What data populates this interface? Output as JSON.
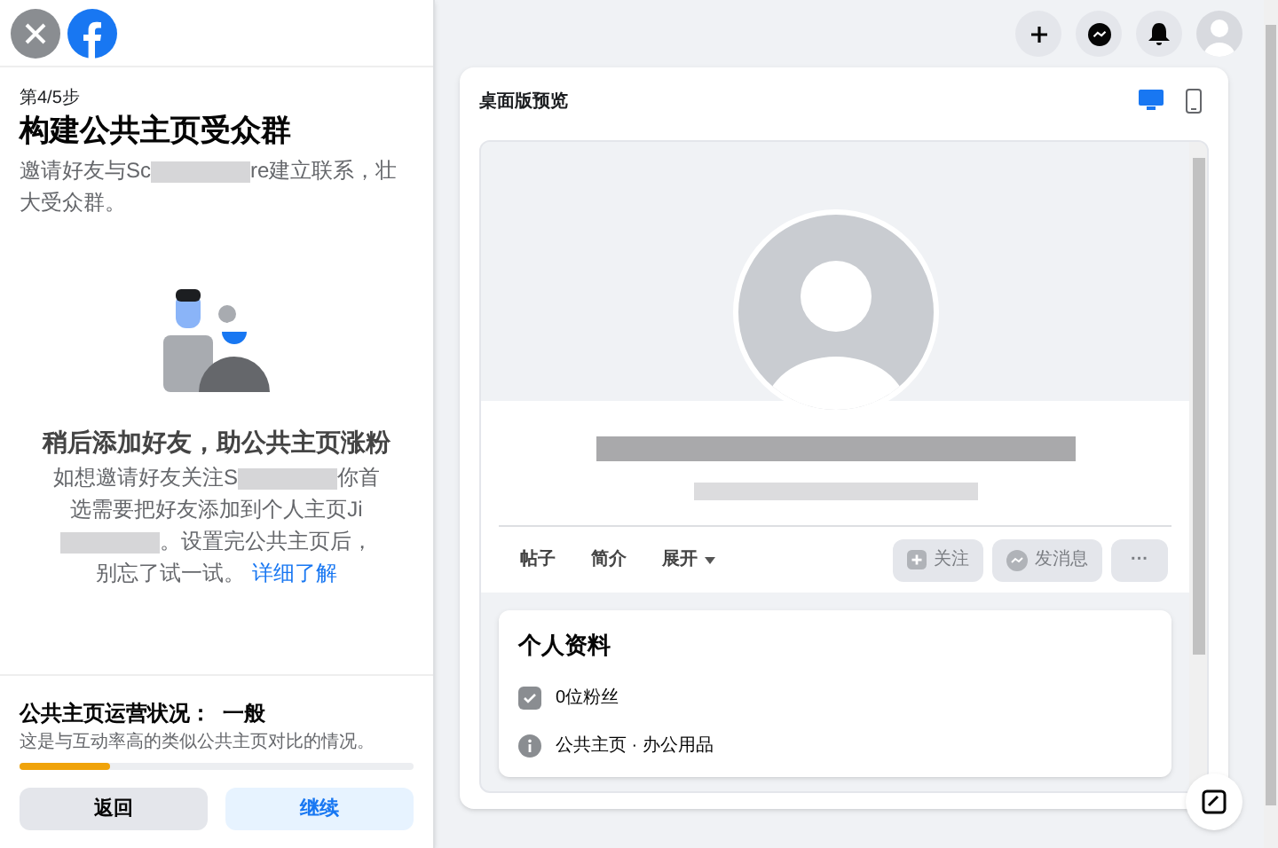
{
  "wizard": {
    "step": "第4/5步",
    "title": "构建公共主页受众群",
    "intro": [
      {
        "kind": "text",
        "text": "邀请好友与Sc"
      },
      {
        "kind": "blur"
      },
      {
        "kind": "text",
        "text": "re建立联系，壮大受众群。"
      }
    ],
    "promo_title": "稍后添加好友，助公共主页涨粉",
    "promo_text": [
      {
        "kind": "text",
        "text": "如想邀请好友关注S"
      },
      {
        "kind": "blur"
      },
      {
        "kind": "text",
        "text": "你首选需要把好友添加到个人主页Ji"
      },
      {
        "kind": "blur"
      },
      {
        "kind": "text",
        "text": "。设置完公共主页后，别忘了试一试。"
      },
      {
        "kind": "link",
        "text": "详细了解"
      }
    ],
    "health_title": "公共主页运营状况：  一般",
    "health_text": "这是与互动率高的类似公共主页对比的情况。",
    "health": {
      "level": 0.23
    },
    "buttons": [
      {
        "kind": "secondary",
        "label": "返回"
      },
      {
        "kind": "primary",
        "label": "继续"
      }
    ]
  },
  "preview": {
    "title": "桌面版预览",
    "devices": [
      {
        "kind": "desktop",
        "selected": true
      },
      {
        "kind": "mobile",
        "selected": false
      }
    ],
    "tabs": [
      {
        "label": "帖子"
      },
      {
        "label": "简介"
      },
      {
        "label": "展开",
        "dropdown": true
      }
    ],
    "actions": [
      {
        "kind": "like",
        "label": "关注",
        "disabled": true
      },
      {
        "kind": "message",
        "label": "发消息",
        "disabled": true
      },
      {
        "kind": "more",
        "label": "···",
        "disabled": true
      }
    ],
    "about_title": "个人资料",
    "about": [
      {
        "kind": "followers",
        "text": "0位粉丝"
      },
      {
        "kind": "info",
        "text": "公共主页 · 办公用品"
      }
    ]
  }
}
